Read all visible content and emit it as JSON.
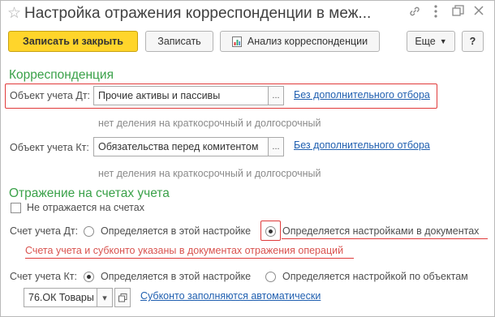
{
  "header": {
    "title": "Настройка отражения корреспонденции в меж...",
    "star_icon": "star-icon",
    "link_icon": "link-icon",
    "menu_icon": "more-vertical-icon",
    "restore_icon": "restore-window-icon",
    "close_icon": "close-icon"
  },
  "toolbar": {
    "save_close_label": "Записать и закрыть",
    "save_label": "Записать",
    "analysis_label": "Анализ корреспонденции",
    "more_label": "Еще",
    "help_label": "?"
  },
  "correspondence": {
    "section_title": "Корреспонденция",
    "dt": {
      "label": "Объект учета Дт:",
      "value": "Прочие активы и пассивы",
      "picker": "...",
      "link": "Без дополнительного отбора",
      "hint": "нет деления на краткосрочный и долгосрочный"
    },
    "kt": {
      "label": "Объект учета Кт:",
      "value": "Обязательства перед комитентом",
      "picker": "...",
      "link": "Без дополнительного отбора",
      "hint": "нет деления на краткосрочный и долгосрочный"
    }
  },
  "accounts": {
    "section_title": "Отражение на счетах учета",
    "not_reflected_label": "Не отражается на счетах",
    "dt": {
      "label": "Счет учета Дт:",
      "option1": "Определяется в этой настройке",
      "option2": "Определяется настройками в документах",
      "selected": "option2",
      "note": "Счета учета и субконто указаны в документах отражения операций"
    },
    "kt": {
      "label": "Счет учета Кт:",
      "option1": "Определяется в этой настройке",
      "option2": "Определяется настройкой по объектам",
      "selected": "option1",
      "account_value": "76.ОК Товары",
      "account_dropdown": "▾",
      "copy_icon": "copy-icon",
      "subconto_link": "Субконто заполняются автоматически"
    }
  },
  "colors": {
    "primary_button": "#ffd52b",
    "section_green": "#3aa149",
    "link_blue": "#1f5fb0",
    "highlight_red": "#e03a3a"
  }
}
